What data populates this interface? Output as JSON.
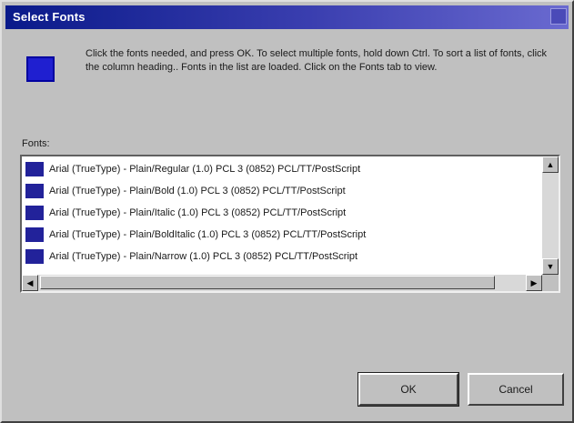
{
  "window": {
    "title": "Select Fonts"
  },
  "message": {
    "text": "Click the fonts needed, and press OK. To select multiple fonts, hold down Ctrl. To sort a list of fonts, click the column heading.. Fonts in the list are loaded. Click on the Fonts tab to view."
  },
  "fonts_label": "Fonts:",
  "font_list": {
    "items": [
      {
        "label": "Arial (TrueType) - Plain/Regular (1.0) PCL 3 (0852) PCL/TT/PostScript"
      },
      {
        "label": "Arial (TrueType) - Plain/Bold (1.0) PCL 3 (0852) PCL/TT/PostScript"
      },
      {
        "label": "Arial (TrueType) - Plain/Italic (1.0) PCL 3 (0852) PCL/TT/PostScript"
      },
      {
        "label": "Arial (TrueType) - Plain/BoldItalic (1.0) PCL 3 (0852) PCL/TT/PostScript"
      },
      {
        "label": "Arial (TrueType) - Plain/Narrow (1.0) PCL 3 (0852) PCL/TT/PostScript"
      }
    ]
  },
  "buttons": {
    "ok": "OK",
    "cancel": "Cancel"
  },
  "icons": {
    "app": "font-dialog-icon",
    "font_item": "truetype-font-icon",
    "scroll_up": "arrow-up-icon",
    "scroll_down": "arrow-down-icon",
    "scroll_left": "arrow-left-icon",
    "scroll_right": "arrow-right-icon"
  },
  "colors": {
    "title_bar": "#0a1a8a",
    "face": "#c0c0c0",
    "icon_blue": "#1f1fd0"
  }
}
